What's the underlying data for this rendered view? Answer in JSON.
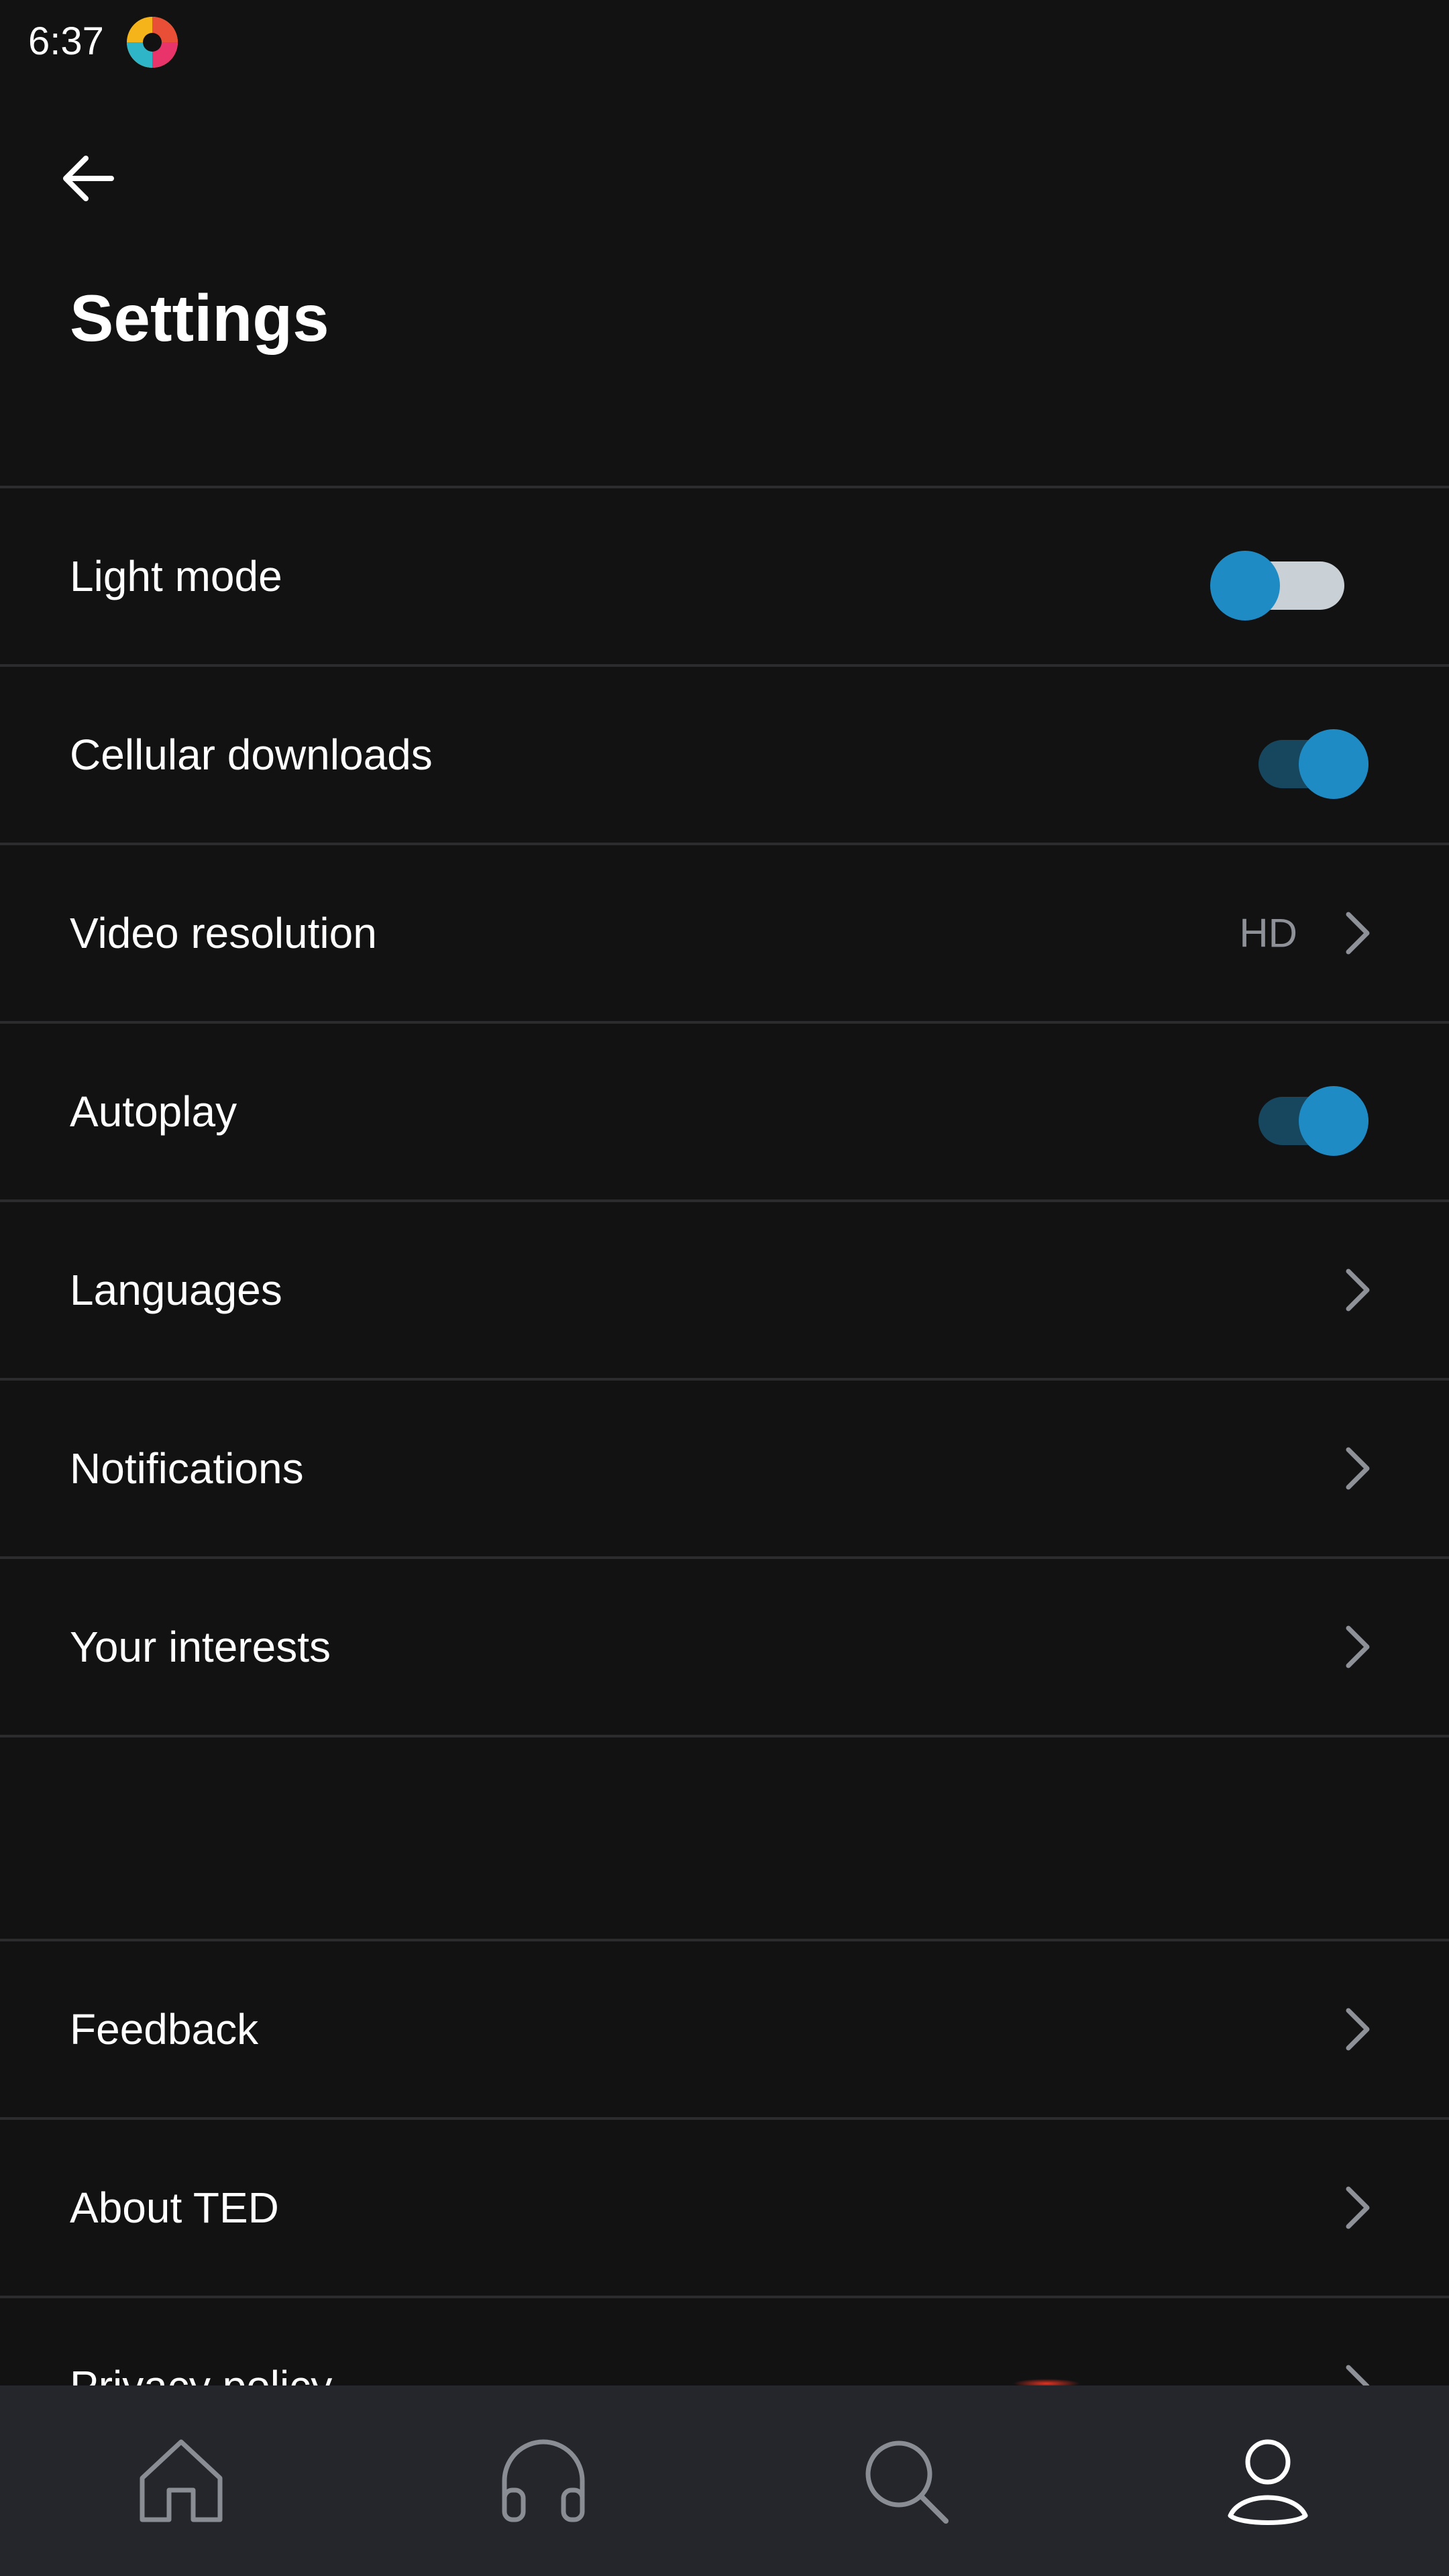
{
  "status_bar": {
    "time": "6:37",
    "app_icon": "app-logo-icon"
  },
  "header": {
    "back_icon": "back-arrow-icon",
    "title": "Settings"
  },
  "settings": {
    "light_mode": {
      "label": "Light mode",
      "toggle_on": false
    },
    "cellular_downloads": {
      "label": "Cellular downloads",
      "toggle_on": true
    },
    "video_resolution": {
      "label": "Video resolution",
      "value": "HD"
    },
    "autoplay": {
      "label": "Autoplay",
      "toggle_on": true
    },
    "languages": {
      "label": "Languages"
    },
    "notifications": {
      "label": "Notifications"
    },
    "your_interests": {
      "label": "Your interests"
    },
    "feedback": {
      "label": "Feedback"
    },
    "about_ted": {
      "label": "About TED"
    },
    "privacy_policy": {
      "label": "Privacy policy"
    }
  },
  "bottom_nav": {
    "items": [
      {
        "icon": "home-icon",
        "active": false
      },
      {
        "icon": "headphones-icon",
        "active": false
      },
      {
        "icon": "search-icon",
        "active": false
      },
      {
        "icon": "profile-icon",
        "active": true
      }
    ]
  },
  "colors": {
    "background": "#121213",
    "divider": "#2c2c2e",
    "accent": "#1f8bc5",
    "nav_background": "#24262b",
    "secondary_text": "#8e9298"
  }
}
